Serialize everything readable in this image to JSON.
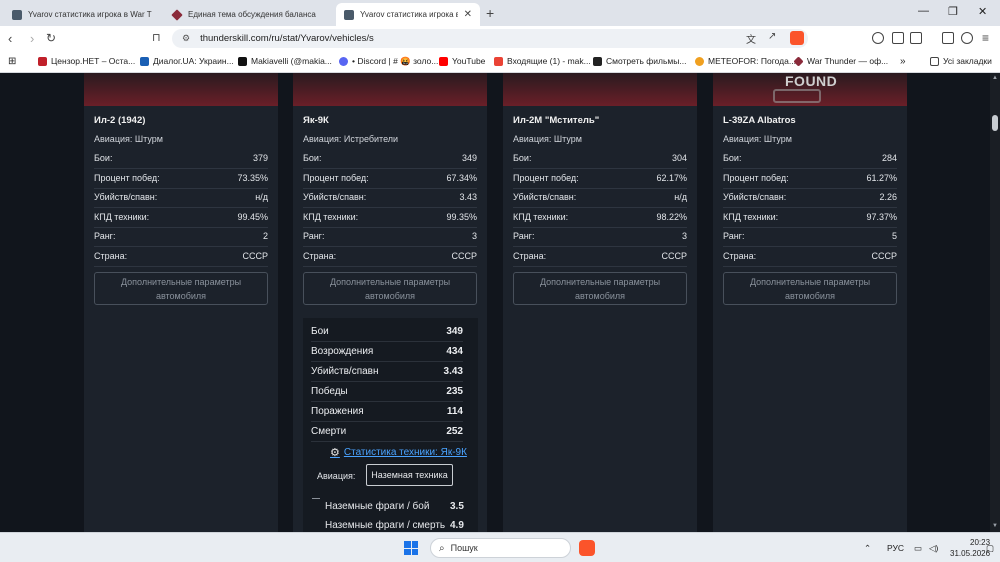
{
  "browser": {
    "tabs": [
      {
        "title": "Yvarov статистика игрока в War Thu",
        "active": false
      },
      {
        "title": "Единая тема обсуждения баланса с",
        "active": false
      },
      {
        "title": "Yvarov статистика игрока в War",
        "active": true
      }
    ],
    "url": "thunderskill.com/ru/stat/Yvarov/vehicles/s",
    "bookmarks": [
      {
        "label": "Цензор.НЕТ – Оста...",
        "icon": "censor-icon",
        "color": "#c0202a"
      },
      {
        "label": "Диалог.UA: Украин...",
        "icon": "dialog-icon",
        "color": "#1a5fb4"
      },
      {
        "label": "Makiavelli (@makia...",
        "icon": "x-icon",
        "color": "#111111"
      },
      {
        "label": "• Discord | # 🤬 золо...",
        "icon": "discord-icon",
        "color": "#5865f2"
      },
      {
        "label": "YouTube",
        "icon": "youtube-icon",
        "color": "#ff0000"
      },
      {
        "label": "Входящие (1) - mak...",
        "icon": "gmail-icon",
        "color": "#ea4335"
      },
      {
        "label": "Смотреть фильмы...",
        "icon": "hd-icon",
        "color": "#222222"
      },
      {
        "label": "METEOFOR: Погода...",
        "icon": "meteofor-icon",
        "color": "#f0a020"
      },
      {
        "label": "War Thunder — оф...",
        "icon": "warthunder-icon",
        "color": "#8a2a3a"
      }
    ],
    "bookmarks_more": "»",
    "all_bookmarks": "Усі закладки"
  },
  "labels": {
    "battles": "Бои:",
    "winrate": "Процент побед:",
    "kpr": "Убийств/спавн:",
    "efficiency": "КПД техники:",
    "rank": "Ранг:",
    "country": "Страна:",
    "more_params": "Дополнительные параметры автомобиля"
  },
  "cards": [
    {
      "name": "Ил-2 (1942)",
      "class": "Авиация:  Штурм",
      "battles": "379",
      "winrate": "73.35%",
      "kpr": "н/д",
      "efficiency": "99.45%",
      "rank": "2",
      "country": "СССР",
      "image": "plane"
    },
    {
      "name": "Як-9К",
      "class": "Авиация:  Истребители",
      "battles": "349",
      "winrate": "67.34%",
      "kpr": "3.43",
      "efficiency": "99.35%",
      "rank": "3",
      "country": "СССР",
      "image": "plane"
    },
    {
      "name": "Ил-2М \"Мститель\"",
      "class": "Авиация:  Штурм",
      "battles": "304",
      "winrate": "62.17%",
      "kpr": "н/д",
      "efficiency": "98.22%",
      "rank": "3",
      "country": "СССР",
      "image": "plane"
    },
    {
      "name": "L-39ZA Albatros",
      "class": "Авиация:  Штурм",
      "battles": "284",
      "winrate": "61.27%",
      "kpr": "2.26",
      "efficiency": "97.37%",
      "rank": "5",
      "country": "СССР",
      "image": "not-found",
      "image_text": "FOUND"
    }
  ],
  "panel": {
    "rows": [
      {
        "label": "Бои",
        "value": "349"
      },
      {
        "label": "Возрождения",
        "value": "434"
      },
      {
        "label": "Убийств/спавн",
        "value": "3.43"
      },
      {
        "label": "Победы",
        "value": "235"
      },
      {
        "label": "Поражения",
        "value": "114"
      },
      {
        "label": "Смерти",
        "value": "252"
      }
    ],
    "stats_link": "Статистика техники: Як-9К",
    "category_label": "Авиация:",
    "category_button": "Наземная техника",
    "frag_rows": [
      {
        "label": "Наземные фраги / бой",
        "value": "3.5"
      },
      {
        "label": "Наземные фраги / смерть",
        "value": "4.9"
      }
    ]
  },
  "taskbar": {
    "search_placeholder": "Пошук",
    "language": "РУС",
    "time": "20:23",
    "date": "31.05.2026"
  }
}
